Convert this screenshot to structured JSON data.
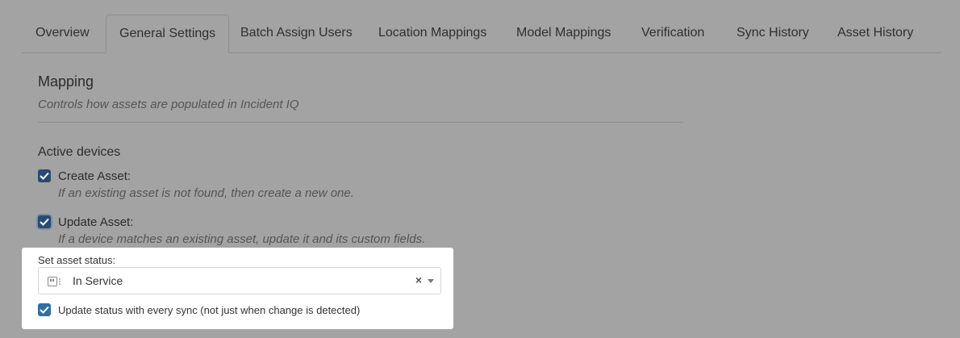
{
  "tabs": [
    {
      "label": "Overview"
    },
    {
      "label": "General Settings",
      "active": true
    },
    {
      "label": "Batch Assign Users"
    },
    {
      "label": "Location Mappings"
    },
    {
      "label": "Model Mappings"
    },
    {
      "label": "Verification"
    },
    {
      "label": "Sync History"
    },
    {
      "label": "Asset History"
    }
  ],
  "mapping": {
    "title": "Mapping",
    "subtitle": "Controls how assets are populated in Incident IQ"
  },
  "active_devices": {
    "title": "Active devices",
    "options": [
      {
        "label": "Create Asset:",
        "description": "If an existing asset is not found, then create a new one.",
        "checked": true
      },
      {
        "label": "Update Asset:",
        "description": "If a device matches an existing asset, update it and its custom fields.",
        "checked": true
      }
    ]
  },
  "asset_status": {
    "label": "Set asset status:",
    "selected_value": "In Service",
    "clear_glyph": "×",
    "update_every_sync": {
      "label": "Update status with every sync (not just when change is detected)",
      "checked": true
    }
  },
  "colors": {
    "overlay": "#a3a3a3",
    "checkbox": "#274b73",
    "checkbox_panel": "#2f6fa8",
    "panel": "#ffffff"
  }
}
